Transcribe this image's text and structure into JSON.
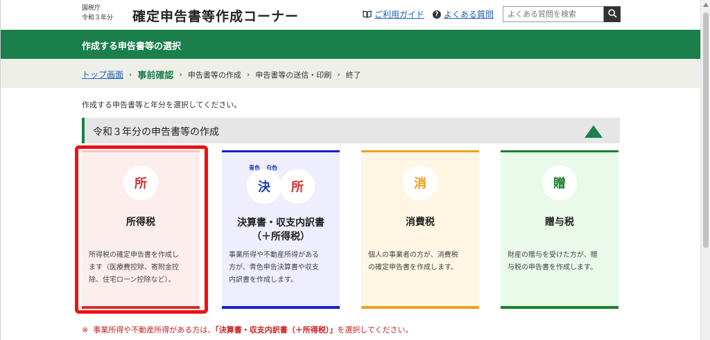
{
  "header": {
    "agency_line1": "国税庁",
    "agency_line2": "令和３年分",
    "site_title": "確定申告書等作成コーナー",
    "guide_link": "ご利用ガイド",
    "faq_link": "よくある質問",
    "search_placeholder": "よくある質問を検索"
  },
  "green_bar": {
    "title": "作成する申告書等の選択"
  },
  "breadcrumb": {
    "items": [
      "トップ画面",
      "事前確認",
      "申告書等の作成",
      "申告書等の送信・印刷",
      "終了"
    ]
  },
  "instruction": "作成する申告書等と年分を選択してください。",
  "section": {
    "title": "令和３年分の申告書等の作成"
  },
  "cards": [
    {
      "icon_char": "所",
      "title": "所得税",
      "desc_lines": [
        "所得税の確定申告書を作成し",
        "ます（医療費控除、寄附金控",
        "除、住宅ローン控除など）。"
      ],
      "color": "#d03030",
      "bg": "#fdeeee",
      "line_color": "#d03030"
    },
    {
      "icon_char1": "決",
      "icon_char2": "所",
      "tag1": "青色",
      "tag2": "白色",
      "title_line1": "決算書・収支内訳書",
      "title_line2": "（＋所得税）",
      "desc_lines": [
        "事業所得や不動産所得がある",
        "方が、青色申告決算書や収支",
        "内訳書を作成します。"
      ],
      "color1": "#1a3fb4",
      "color2": "#d03030",
      "line_color": "#1020d0"
    },
    {
      "icon_char": "消",
      "title": "消費税",
      "desc_lines": [
        "個人の事業者の方が、消費税",
        "の確定申告書を作成します。"
      ],
      "color": "#f09a10",
      "line_color": "#f0a020"
    },
    {
      "icon_char": "贈",
      "title": "贈与税",
      "desc_lines": [
        "財産の贈与を受けた方が、贈",
        "与税の申告書を作成します。"
      ],
      "color": "#1a7f2b",
      "line_color": "#1a7f2b"
    }
  ],
  "note": {
    "mark": "※",
    "part1": "事業所得や不動産所得がある方は、",
    "part2": "「決算書・収支内訳書（＋所得税）」",
    "part3": "を選択してください。"
  },
  "colors": {
    "brand_green": "#1a7f4b",
    "highlight_red": "#ee1111",
    "link_blue": "#1a5fb4"
  }
}
